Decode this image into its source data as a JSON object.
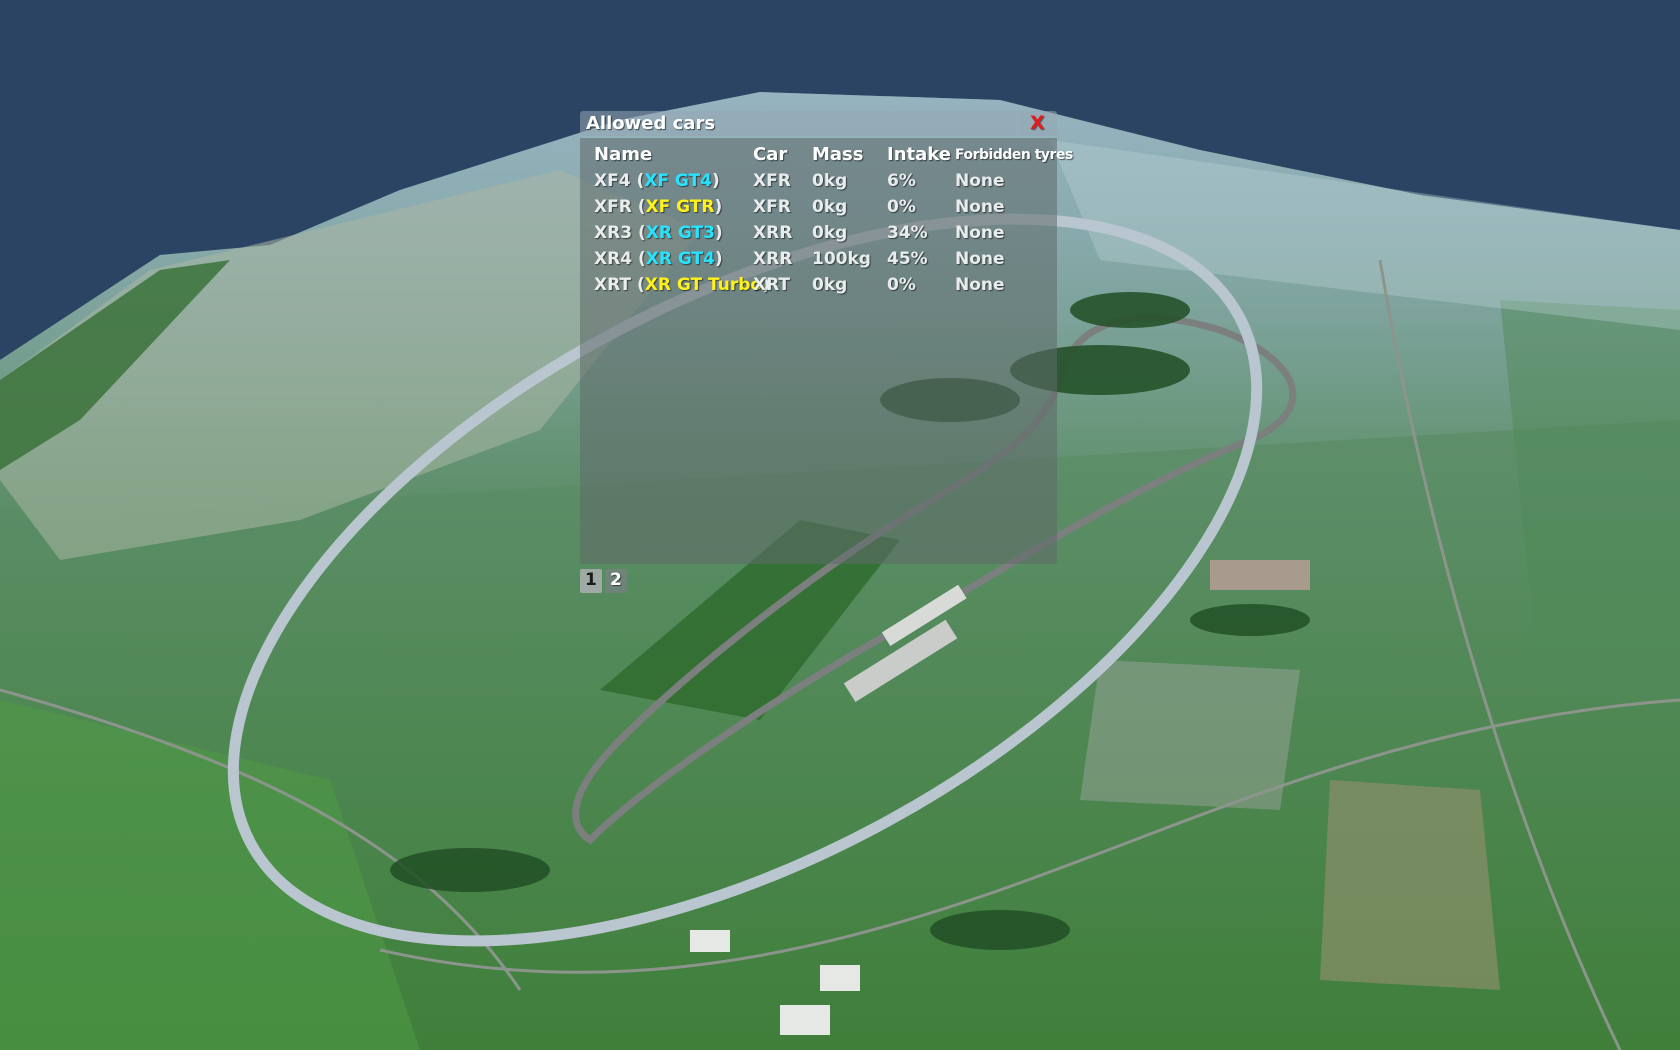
{
  "dialog": {
    "title": "Allowed cars",
    "close_label": "X",
    "columns": [
      "Name",
      "Car",
      "Mass",
      "Intake",
      "Forbidden tyres"
    ],
    "rows": [
      {
        "name": "XF4 (",
        "car_name": "XF GT4",
        "name_end": ")",
        "car_color": "#27e3ff",
        "car": "XFR",
        "mass": "0kg",
        "intake": "6%",
        "tyres": "None"
      },
      {
        "name": "XFR (",
        "car_name": "XF GTR",
        "name_end": ")",
        "car_color": "#fff21a",
        "car": "XFR",
        "mass": "0kg",
        "intake": "0%",
        "tyres": "None"
      },
      {
        "name": "XR3 (",
        "car_name": "XR GT3",
        "name_end": ")",
        "car_color": "#27e3ff",
        "car": "XRR",
        "mass": "0kg",
        "intake": "34%",
        "tyres": "None"
      },
      {
        "name": "XR4 (",
        "car_name": "XR GT4",
        "name_end": ")",
        "car_color": "#27e3ff",
        "car": "XRR",
        "mass": "100kg",
        "intake": "45%",
        "tyres": "None"
      },
      {
        "name": "XRT (",
        "car_name": "XR GT Turbo",
        "name_end": ")",
        "car_color": "#fff21a",
        "car": "XRT",
        "mass": "0kg",
        "intake": "0%",
        "tyres": "None"
      }
    ]
  },
  "pager": {
    "pages": [
      "1",
      "2"
    ],
    "current": "1"
  },
  "colors": {
    "sky": "#2b4463",
    "close_x": "#e51b1b",
    "highlight_cyan": "#27e3ff",
    "highlight_yellow": "#fff21a"
  }
}
